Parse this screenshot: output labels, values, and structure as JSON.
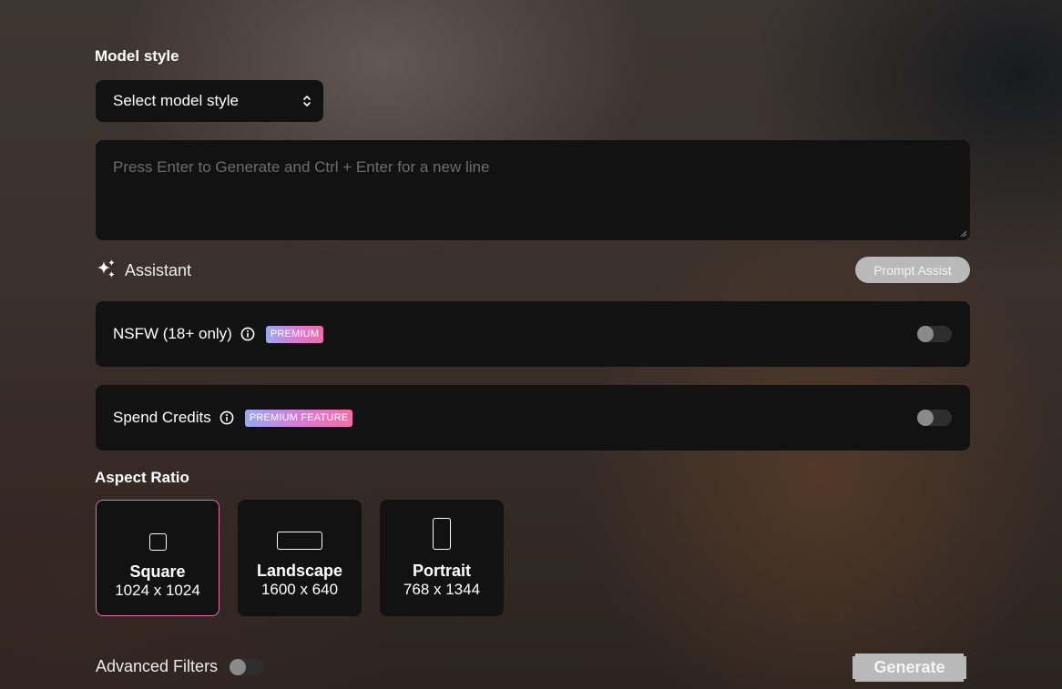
{
  "model_style": {
    "label": "Model style",
    "select_value": "Select model style"
  },
  "prompt": {
    "placeholder": "Press Enter to Generate and Ctrl + Enter for a new line",
    "value": ""
  },
  "assistant": {
    "label": "Assistant",
    "prompt_assist_label": "Prompt Assist"
  },
  "options": [
    {
      "label": "NSFW (18+ only)",
      "badge": "PREMIUM",
      "enabled": false
    },
    {
      "label": "Spend Credits",
      "badge": "PREMIUM FEATURE",
      "enabled": false
    }
  ],
  "aspect_ratio": {
    "label": "Aspect Ratio",
    "selected": "Square",
    "items": [
      {
        "name": "Square",
        "dims": "1024 x 1024"
      },
      {
        "name": "Landscape",
        "dims": "1600 x 640"
      },
      {
        "name": "Portrait",
        "dims": "768 x 1344"
      }
    ]
  },
  "advanced_filters": {
    "label": "Advanced Filters",
    "enabled": false
  },
  "generate_label": "Generate",
  "colors": {
    "card_bg": "#121212",
    "selected_border": "#e46fa2",
    "button_bg": "#b9b9b9",
    "badge_gradient": [
      "#9aa8f5",
      "#d97ad0",
      "#f06fa6"
    ]
  },
  "icons": {
    "select": "chevron-up-down-icon",
    "assistant": "sparkles-icon",
    "info": "info-circle-icon"
  }
}
